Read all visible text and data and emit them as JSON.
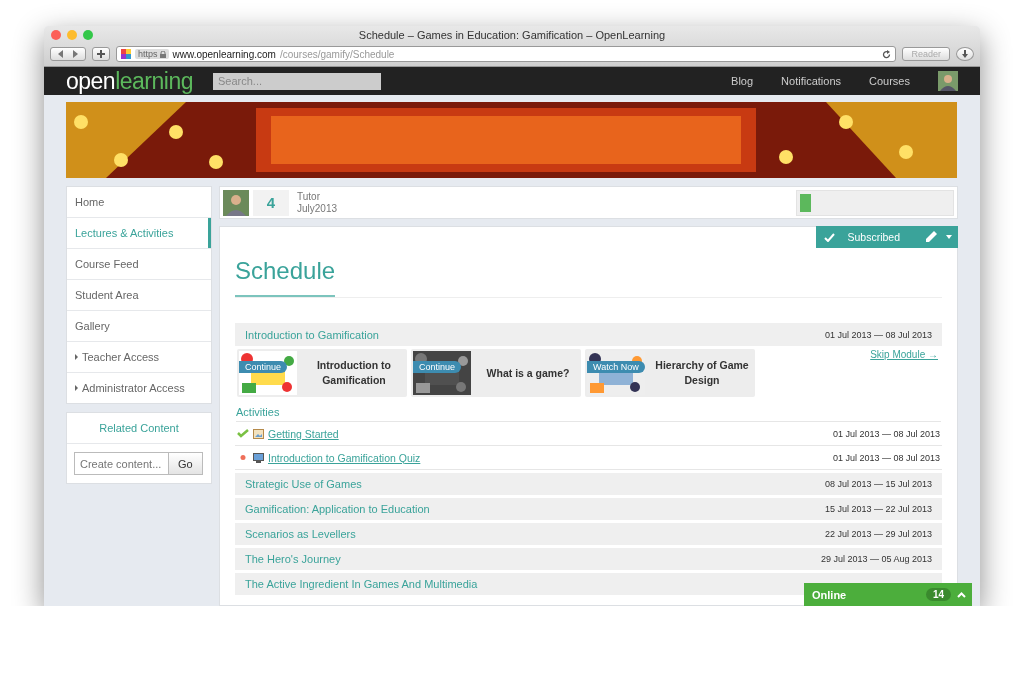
{
  "window": {
    "title": "Schedule – Games in Education: Gamification – OpenLearning"
  },
  "browser": {
    "scheme": "https",
    "url_host": "www.openlearning.com",
    "url_path": "/courses/gamify/Schedule",
    "reader_button": "Reader"
  },
  "nav": {
    "logo_part_1": "open",
    "logo_part_2": "learning",
    "search_placeholder": "Search...",
    "links": [
      "Blog",
      "Notifications",
      "Courses"
    ]
  },
  "sidebar": {
    "items": [
      {
        "label": "Home",
        "selected": false,
        "expandable": false
      },
      {
        "label": "Lectures & Activities",
        "selected": true,
        "expandable": false
      },
      {
        "label": "Course Feed",
        "selected": false,
        "expandable": false
      },
      {
        "label": "Student Area",
        "selected": false,
        "expandable": false
      },
      {
        "label": "Gallery",
        "selected": false,
        "expandable": false
      },
      {
        "label": "Teacher Access",
        "selected": false,
        "expandable": true
      },
      {
        "label": "Administrator Access",
        "selected": false,
        "expandable": true
      }
    ]
  },
  "related": {
    "title": "Related Content",
    "placeholder": "Create content...",
    "button": "Go"
  },
  "course_header": {
    "number": "4",
    "role": "Tutor",
    "cohort": "July2013",
    "progress": {
      "level": 0.07
    }
  },
  "subscribe_button": "Subscribed",
  "heading": "Schedule",
  "modules": [
    {
      "title": "Introduction to Gamification",
      "dates": "01 Jul 2013 — 08 Jul 2013",
      "skip_link": "Skip Module →",
      "lessons": [
        {
          "action": "Continue",
          "title": "Introduction to Gamification"
        },
        {
          "action": "Continue",
          "title": "What is a game?"
        },
        {
          "action": "Watch Now",
          "title": "Hierarchy of Game Design"
        }
      ],
      "activities_title": "Activities",
      "activities": [
        {
          "title": "Getting Started",
          "dates": "01 Jul 2013 — 08 Jul 2013",
          "completed": true
        },
        {
          "title": "Introduction to Gamification Quiz",
          "dates": "01 Jul 2013 — 08 Jul 2013",
          "completed": false
        }
      ]
    },
    {
      "title": "Strategic Use of Games",
      "dates": "08 Jul 2013 — 15 Jul 2013"
    },
    {
      "title": "Gamification: Application to Education",
      "dates": "15 Jul 2013 — 22 Jul 2013"
    },
    {
      "title": "Scenarios as Levellers",
      "dates": "22 Jul 2013 — 29 Jul 2013"
    },
    {
      "title": "The Hero's Journey",
      "dates": "29 Jul 2013 — 05 Aug 2013"
    },
    {
      "title": "The Active Ingredient In Games And Multimedia"
    }
  ],
  "online": {
    "label": "Online",
    "count": "14"
  }
}
